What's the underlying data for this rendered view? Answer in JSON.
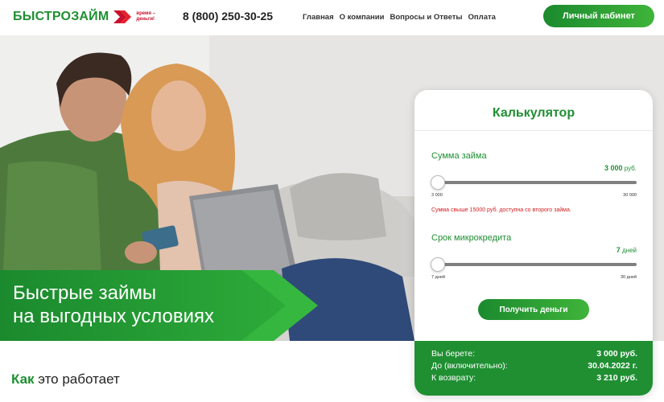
{
  "header": {
    "logo": "БЫСТРОЗАЙМ",
    "logo_tagline": "время – деньги!",
    "phone": "8 (800) 250-30-25",
    "nav": [
      "Главная",
      "О компании",
      "Вопросы и Ответы",
      "Оплата"
    ],
    "cabinet_button": "Личный кабинет"
  },
  "hero": {
    "title_line1": "Быстрые займы",
    "title_line2": "на выгодных условиях"
  },
  "calculator": {
    "title": "Калькулятор",
    "amount": {
      "label": "Сумма займа",
      "value": "3 000",
      "unit": "руб.",
      "min_label": "3 000",
      "max_label": "30 000",
      "level": 0,
      "warning": "Сумма свыше 15000 руб. доступна со второго займа."
    },
    "term": {
      "label": "Срок микрокредита",
      "value": "7",
      "unit": "дней",
      "min_label": "7 дней",
      "max_label": "30 дней",
      "level": 0
    },
    "button": "Получить деньги",
    "summary": {
      "take_label": "Вы берете:",
      "take_value": "3 000 руб.",
      "until_label": "До (включительно):",
      "until_value": "30.04.2022 г.",
      "return_label": "К возврату:",
      "return_value": "3 210 руб."
    }
  },
  "section": {
    "how_highlight": "Как",
    "how_rest": "это работает"
  },
  "colors": {
    "brand_green": "#1f8f32",
    "accent_red": "#c8102e",
    "warning_red": "#d21f1f"
  }
}
